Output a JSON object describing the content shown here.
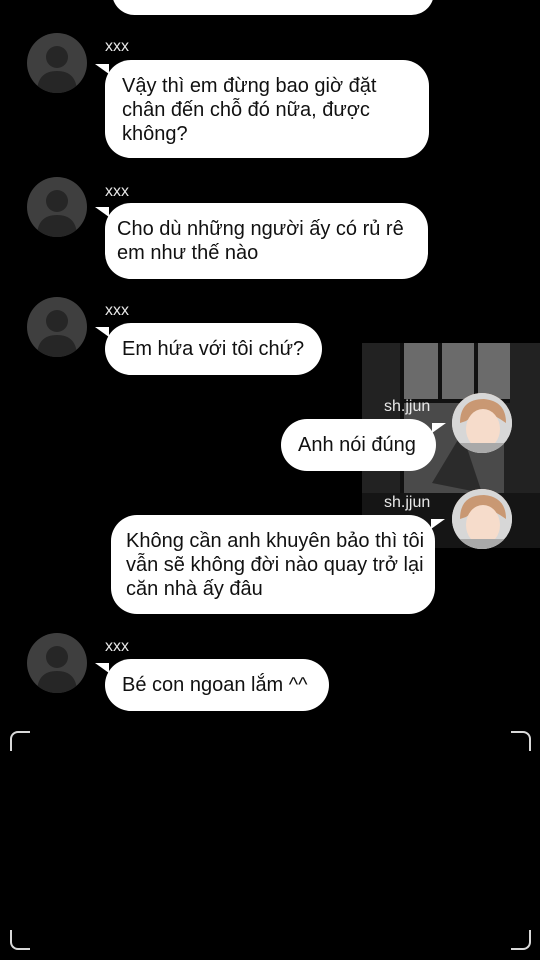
{
  "messages": [
    {
      "sender": "xxx",
      "text": "Vậy thì em đừng bao giờ đặt chân đến chỗ đó nữa, được không?"
    },
    {
      "sender": "xxx",
      "text": "Cho dù những người ấy có rủ rê em như thế nào"
    },
    {
      "sender": "xxx",
      "text": "Em hứa với tôi chứ?"
    },
    {
      "sender": "sh.jjun",
      "text": "Anh nói đúng"
    },
    {
      "sender": "sh.jjun",
      "text": "Không cần anh khuyên bảo thì tôi vẫn sẽ không đời nào quay trở lại căn nhà ấy đâu"
    },
    {
      "sender": "xxx",
      "text": "Bé con ngoan lắm ^^"
    }
  ],
  "colors": {
    "background": "#000000",
    "bubble": "#ffffff",
    "name_text": "#e8e8e8"
  },
  "icons": {
    "default_avatar": "person-silhouette-icon",
    "photo_avatar": "user-photo-avatar"
  }
}
